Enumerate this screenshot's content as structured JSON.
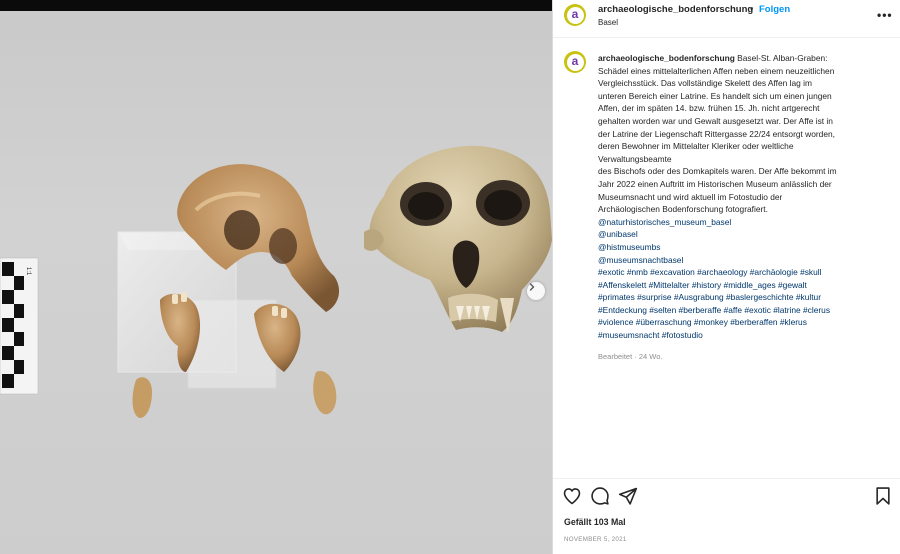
{
  "post": {
    "username": "archaeologische_bodenforschung",
    "avatar_letter": "a",
    "follow_label": "Folgen",
    "separator": "•",
    "location": "Basel",
    "more_label": "•••"
  },
  "caption": {
    "username": "archaeologische_bodenforschung",
    "first_line_text": "Basel-St. Alban-Graben:",
    "lines": [
      "Schädel eines mittelalterlichen Affen neben einem neuzeitlichen",
      "Vergleichsstück. Das vollständige Skelett des Affen lag im",
      "unteren Bereich einer Latrine. Es handelt sich um einen jungen",
      "Affen, der im späten 14. bzw. frühen 15. Jh. nicht artgerecht",
      "gehalten worden war und Gewalt ausgesetzt war. Der Affe ist in",
      "der Latrine der Liegenschaft Rittergasse 22/24 entsorgt worden,",
      "deren Bewohner im Mittelalter Kleriker oder weltliche",
      "Verwaltungsbeamte",
      "des Bischofs oder des Domkapitels waren. Der Affe bekommt im",
      "Jahr 2022 einen Auftritt im Historischen Museum anlässlich der",
      "Museumsnacht und wird aktuell im Fotostudio der",
      "Archäologischen Bodenforschung fotografiert."
    ],
    "mentions": [
      "@naturhistorisches_museum_basel",
      "@unibasel",
      "@histmuseumbs",
      "@museumsnachtbasel"
    ],
    "hashtag_lines": [
      "#exotic #nmb #excavation #archaeology #archäologie #skull",
      "#Affenskelett #Mittelalter #history #middle_ages #gewalt",
      "#primates #surprise #Ausgrabung #baslergeschichte #kultur",
      "#Entdeckung #selten #berberaffe #affe #exotic #latrine #clerus",
      "#violence #überraschung #monkey #berberaffen #klerus",
      "#museumsnacht #fotostudio"
    ],
    "edited_label": "Bearbeitet · 24 Wo."
  },
  "footer": {
    "likes_label": "Gefällt 103 Mal",
    "date_label": "NOVEMBER 5, 2021"
  },
  "photo": {
    "alt": "Schädel eines mittelalterlichen Affen neben einem neuzeitlichen Vergleichsstück",
    "scale_text": "1:1"
  },
  "colors": {
    "link": "#00376b",
    "follow": "#0095f6",
    "avatar_ring": "#c8c213",
    "avatar_letter": "#6f3aa6",
    "muted": "#8e8e8e"
  },
  "icons": [
    "heart-icon",
    "comment-icon",
    "share-icon",
    "bookmark-icon",
    "chevron-right-icon",
    "more-icon"
  ]
}
